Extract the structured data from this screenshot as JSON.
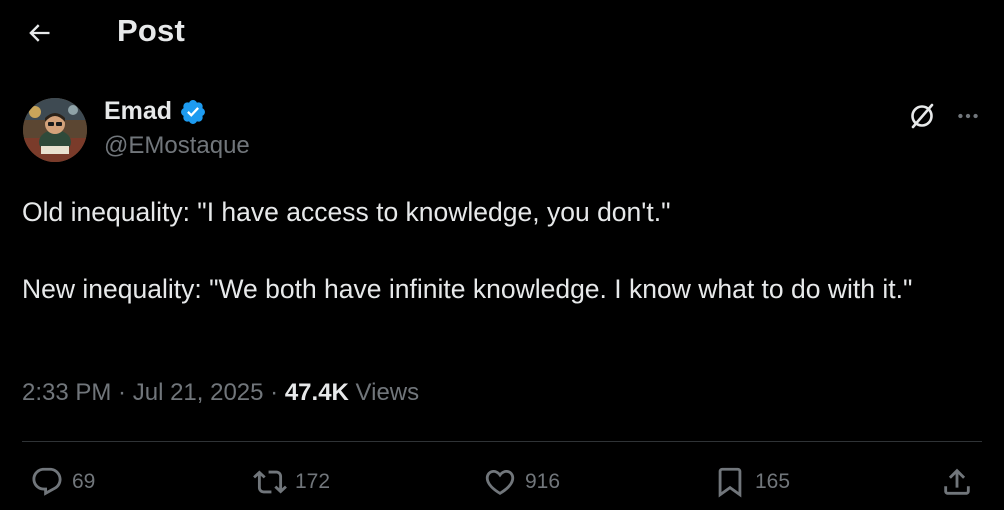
{
  "header": {
    "title": "Post",
    "back_icon": "arrow-left-icon"
  },
  "author": {
    "display_name": "Emad",
    "handle": "@EMostaque",
    "verified": true,
    "verified_color": "#1d9bf0"
  },
  "post": {
    "text": "Old inequality: \"I have access to knowledge, you don't.\"\n\nNew inequality: \"We both have infinite knowledge. I know what to do with it.\"",
    "time": "2:33 PM",
    "date": "Jul 21, 2025",
    "views_count": "47.4K",
    "views_label": "Views"
  },
  "actions": {
    "replies": "69",
    "reposts": "172",
    "likes": "916",
    "bookmarks": "165"
  },
  "colors": {
    "background": "#000000",
    "text_primary": "#e7e9ea",
    "text_secondary": "#71767b",
    "divider": "#2f3336"
  }
}
